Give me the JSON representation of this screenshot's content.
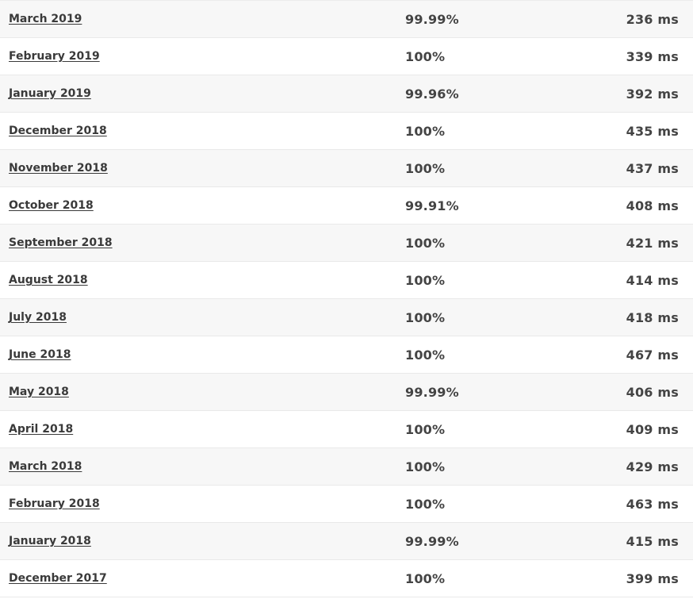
{
  "rows": [
    {
      "month": "March 2019",
      "uptime": "99.99%",
      "response_time": "236 ms"
    },
    {
      "month": "February 2019",
      "uptime": "100%",
      "response_time": "339 ms"
    },
    {
      "month": "January 2019",
      "uptime": "99.96%",
      "response_time": "392 ms"
    },
    {
      "month": "December 2018",
      "uptime": "100%",
      "response_time": "435 ms"
    },
    {
      "month": "November 2018",
      "uptime": "100%",
      "response_time": "437 ms"
    },
    {
      "month": "October 2018",
      "uptime": "99.91%",
      "response_time": "408 ms"
    },
    {
      "month": "September 2018",
      "uptime": "100%",
      "response_time": "421 ms"
    },
    {
      "month": "August 2018",
      "uptime": "100%",
      "response_time": "414 ms"
    },
    {
      "month": "July 2018",
      "uptime": "100%",
      "response_time": "418 ms"
    },
    {
      "month": "June 2018",
      "uptime": "100%",
      "response_time": "467 ms"
    },
    {
      "month": "May 2018",
      "uptime": "99.99%",
      "response_time": "406 ms"
    },
    {
      "month": "April 2018",
      "uptime": "100%",
      "response_time": "409 ms"
    },
    {
      "month": "March 2018",
      "uptime": "100%",
      "response_time": "429 ms"
    },
    {
      "month": "February 2018",
      "uptime": "100%",
      "response_time": "463 ms"
    },
    {
      "month": "January 2018",
      "uptime": "99.99%",
      "response_time": "415 ms"
    },
    {
      "month": "December 2017",
      "uptime": "100%",
      "response_time": "399 ms"
    }
  ],
  "colors": {
    "text": "#444444",
    "row_alt_bg": "#f7f7f7",
    "row_bg": "#ffffff",
    "border": "#e9e9e9"
  }
}
